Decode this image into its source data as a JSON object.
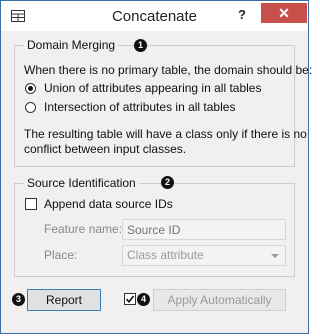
{
  "window": {
    "title": "Concatenate",
    "help": "?",
    "close": "✕"
  },
  "domain_merging": {
    "title": "Domain Merging",
    "badge": "1",
    "prompt": "When there is no primary table, the domain should be:",
    "option_union": "Union of attributes appearing in all tables",
    "option_intersection": "Intersection of attributes in all tables",
    "selected": "union",
    "note_line1": "The resulting table will have a class only if there is no",
    "note_line2": "conflict between input classes."
  },
  "source_identification": {
    "title": "Source Identification",
    "badge": "2",
    "append_label": "Append data source IDs",
    "append_checked": false,
    "feature_name_label": "Feature name:",
    "feature_name_placeholder": "Source ID",
    "place_label": "Place:",
    "place_value": "Class attribute"
  },
  "footer": {
    "report_badge": "3",
    "report_label": "Report",
    "auto_checked": true,
    "auto_badge": "4",
    "apply_label": "Apply Automatically"
  }
}
